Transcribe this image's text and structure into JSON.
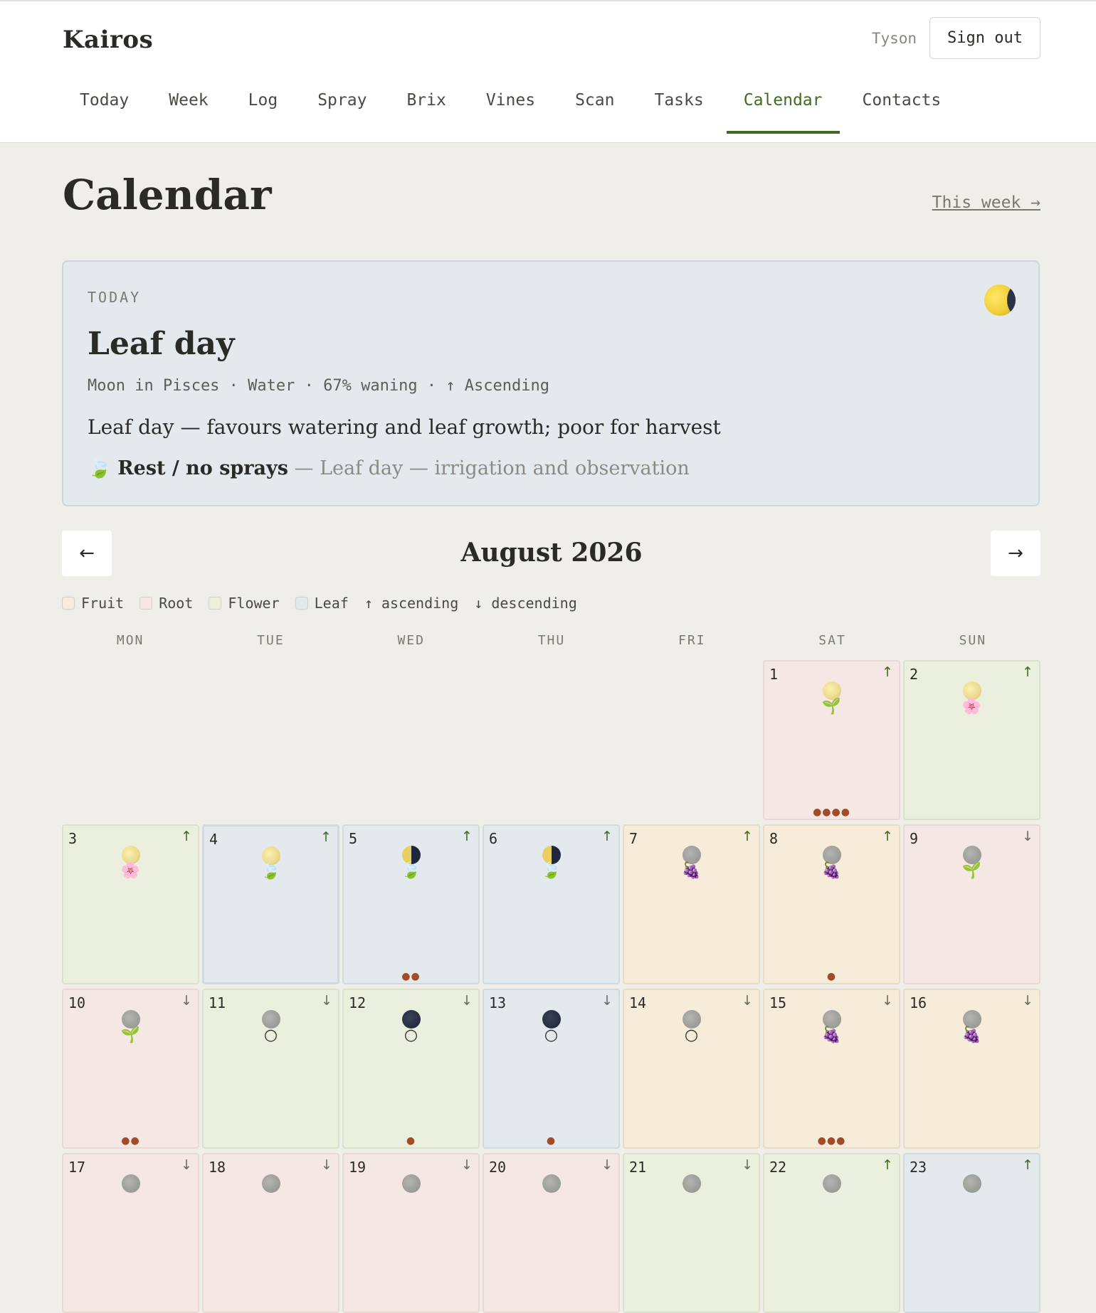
{
  "app": {
    "brand": "Kairos",
    "user": "Tyson",
    "sign_out": "Sign out"
  },
  "nav": [
    "Today",
    "Week",
    "Log",
    "Spray",
    "Brix",
    "Vines",
    "Scan",
    "Tasks",
    "Calendar",
    "Contacts"
  ],
  "nav_active": "Calendar",
  "page": {
    "title": "Calendar",
    "this_week_link": "This week →"
  },
  "today": {
    "label": "TODAY",
    "title": "Leaf day",
    "meta": "Moon in Pisces · Water · 67% waning · ↑ Ascending",
    "description": "Leaf day — favours watering and leaf growth; poor for harvest",
    "spray_icon": "🍃",
    "spray_title": "Rest / no sprays",
    "spray_note": " — Leaf day — irrigation and observation"
  },
  "month": {
    "title": "August 2026",
    "prev": "←",
    "next": "→"
  },
  "legend": [
    {
      "label": "Fruit",
      "color": "#f6ecd9"
    },
    {
      "label": "Root",
      "color": "#f5e8e4"
    },
    {
      "label": "Flower",
      "color": "#ebefdd"
    },
    {
      "label": "Leaf",
      "color": "#e3e9ec"
    }
  ],
  "legend_dirs": {
    "ascending": "↑ ascending",
    "descending": "↓ descending"
  },
  "weekdays": [
    "MON",
    "TUE",
    "WED",
    "THU",
    "FRI",
    "SAT",
    "SUN"
  ],
  "days": [
    {
      "n": "1",
      "type": "root",
      "dir": "↑",
      "moon": "bright",
      "sym": "🌱",
      "dots": "●●●●"
    },
    {
      "n": "2",
      "type": "flower",
      "dir": "↑",
      "moon": "bright",
      "sym": "🌸",
      "dots": ""
    },
    {
      "n": "3",
      "type": "flower",
      "dir": "↑",
      "moon": "bright",
      "sym": "🌸",
      "dots": ""
    },
    {
      "n": "4",
      "type": "leaf",
      "dir": "↑",
      "moon": "bright",
      "sym": "🍃",
      "dots": "",
      "today": true
    },
    {
      "n": "5",
      "type": "leaf",
      "dir": "↑",
      "moon": "half",
      "sym": "🍃",
      "dots": "●●"
    },
    {
      "n": "6",
      "type": "leaf",
      "dir": "↑",
      "moon": "half",
      "sym": "🍃",
      "dots": ""
    },
    {
      "n": "7",
      "type": "fruit",
      "dir": "↑",
      "moon": "gray",
      "sym": "🍇",
      "dots": ""
    },
    {
      "n": "8",
      "type": "fruit",
      "dir": "↑",
      "moon": "gray",
      "sym": "🍇",
      "dots": "●"
    },
    {
      "n": "9",
      "type": "root",
      "dir": "↓",
      "moon": "gray",
      "sym": "🌱",
      "dots": ""
    },
    {
      "n": "10",
      "type": "root",
      "dir": "↓",
      "moon": "gray",
      "sym": "🌱",
      "dots": "●●"
    },
    {
      "n": "11",
      "type": "flower",
      "dir": "↓",
      "moon": "gray",
      "sym": "○",
      "dots": ""
    },
    {
      "n": "12",
      "type": "flower",
      "dir": "↓",
      "moon": "dark",
      "sym": "○",
      "dots": "●"
    },
    {
      "n": "13",
      "type": "leaf",
      "dir": "↓",
      "moon": "dark",
      "sym": "○",
      "dots": "●"
    },
    {
      "n": "14",
      "type": "fruit",
      "dir": "↓",
      "moon": "gray",
      "sym": "○",
      "dots": ""
    },
    {
      "n": "15",
      "type": "fruit",
      "dir": "↓",
      "moon": "gray",
      "sym": "🍇",
      "dots": "●●●"
    },
    {
      "n": "16",
      "type": "fruit",
      "dir": "↓",
      "moon": "gray",
      "sym": "🍇",
      "dots": ""
    },
    {
      "n": "17",
      "type": "root",
      "dir": "↓",
      "moon": "gray",
      "sym": "",
      "dots": ""
    },
    {
      "n": "18",
      "type": "root",
      "dir": "↓",
      "moon": "gray",
      "sym": "",
      "dots": ""
    },
    {
      "n": "19",
      "type": "root",
      "dir": "↓",
      "moon": "gray",
      "sym": "",
      "dots": ""
    },
    {
      "n": "20",
      "type": "root",
      "dir": "↓",
      "moon": "gray",
      "sym": "",
      "dots": ""
    },
    {
      "n": "21",
      "type": "flower",
      "dir": "↓",
      "moon": "gray",
      "sym": "",
      "dots": ""
    },
    {
      "n": "22",
      "type": "flower",
      "dir": "↑",
      "moon": "gray",
      "sym": "",
      "dots": ""
    },
    {
      "n": "23",
      "type": "leaf",
      "dir": "↑",
      "moon": "gray",
      "sym": "",
      "dots": ""
    }
  ]
}
